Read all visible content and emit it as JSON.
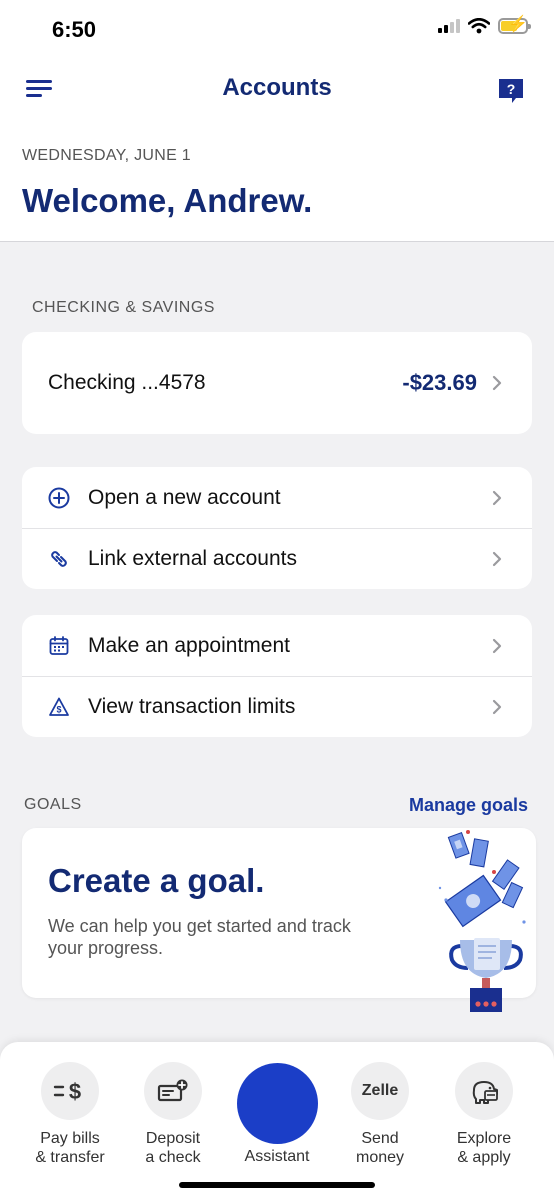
{
  "status_bar": {
    "time": "6:50"
  },
  "header": {
    "title": "Accounts"
  },
  "welcome": {
    "date": "WEDNESDAY, JUNE 1",
    "greeting": "Welcome, Andrew."
  },
  "checking_savings": {
    "label": "CHECKING & SAVINGS",
    "accounts": [
      {
        "name": "Checking ...4578",
        "balance": "-$23.69"
      }
    ]
  },
  "account_actions": [
    {
      "label": "Open a new account",
      "icon": "plus-circle-icon"
    },
    {
      "label": "Link external accounts",
      "icon": "link-icon"
    }
  ],
  "service_actions": [
    {
      "label": "Make an appointment",
      "icon": "calendar-icon"
    },
    {
      "label": "View transaction limits",
      "icon": "limit-warning-icon"
    }
  ],
  "goals": {
    "label": "GOALS",
    "manage_link": "Manage goals",
    "card_title": "Create a goal.",
    "card_description": "We can help you get started and track your progress."
  },
  "bottom_nav": {
    "items": [
      {
        "line1": "Pay bills",
        "line2": "& transfer",
        "icon": "pay-bills-icon"
      },
      {
        "line1": "Deposit",
        "line2": "a check",
        "icon": "deposit-check-icon"
      },
      {
        "line1": "Send",
        "line2": "money",
        "icon": "zelle-icon",
        "icon_text": "Zelle"
      },
      {
        "line1": "Explore",
        "line2": "& apply",
        "icon": "piggy-bank-icon"
      }
    ],
    "assistant_label": "Assistant"
  },
  "colors": {
    "brand_navy": "#132a73",
    "accent_blue": "#1b3ec7",
    "background": "#f1f1f3"
  }
}
